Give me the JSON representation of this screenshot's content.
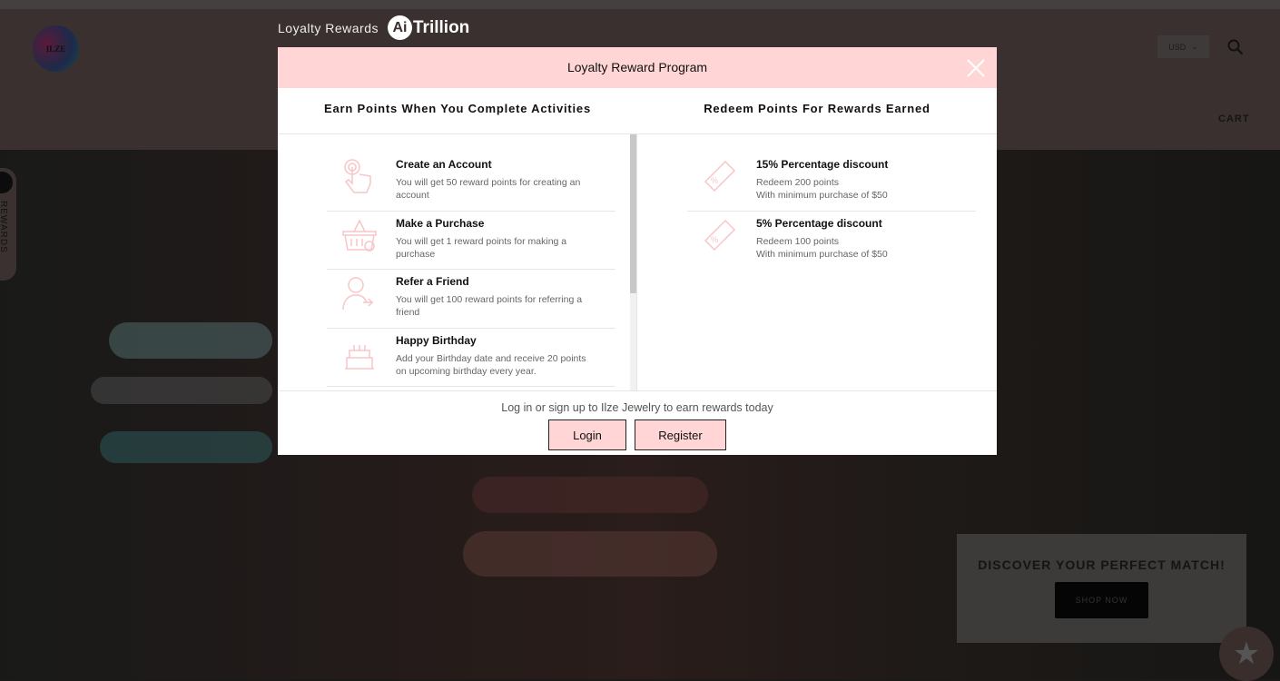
{
  "store": {
    "logo_text": "ILZE",
    "currency": "USD",
    "cart_label": "CART",
    "rewards_tab": "REWARDS",
    "promo_title": "DISCOVER YOUR PERFECT MATCH!",
    "promo_button": "SHOP NOW"
  },
  "brand": {
    "label": "Loyalty Rewards",
    "logo_ai": "Ai",
    "logo_name": "Trillion"
  },
  "modal": {
    "title": "Loyalty Reward Program",
    "earn_heading": "Earn Points When You Complete Activities",
    "redeem_heading": "Redeem Points For Rewards Earned",
    "earn": [
      {
        "icon": "tap-hand",
        "title": "Create an Account",
        "desc": "You will get 50 reward points for creating an account"
      },
      {
        "icon": "shopping-basket",
        "title": "Make a Purchase",
        "desc": "You will get 1 reward points for making a purchase"
      },
      {
        "icon": "refer-user",
        "title": "Refer a Friend",
        "desc": "You will get 100 reward points for referring a friend"
      },
      {
        "icon": "birthday-cake",
        "title": "Happy Birthday",
        "desc": "Add your Birthday date and receive 20 points on upcoming birthday every year."
      }
    ],
    "redeem": [
      {
        "icon": "coupon",
        "title": "15% Percentage discount",
        "line1": "Redeem 200 points",
        "line2": "With minimum purchase of $50"
      },
      {
        "icon": "coupon",
        "title": "5% Percentage discount",
        "line1": "Redeem 100 points",
        "line2": "With minimum purchase of $50"
      }
    ],
    "footer_text": "Log in or sign up to Ilze Jewelry to earn rewards today",
    "login": "Login",
    "register": "Register"
  },
  "colors": {
    "accent": "#ffd5d6",
    "icon": "#f9c5c6"
  }
}
